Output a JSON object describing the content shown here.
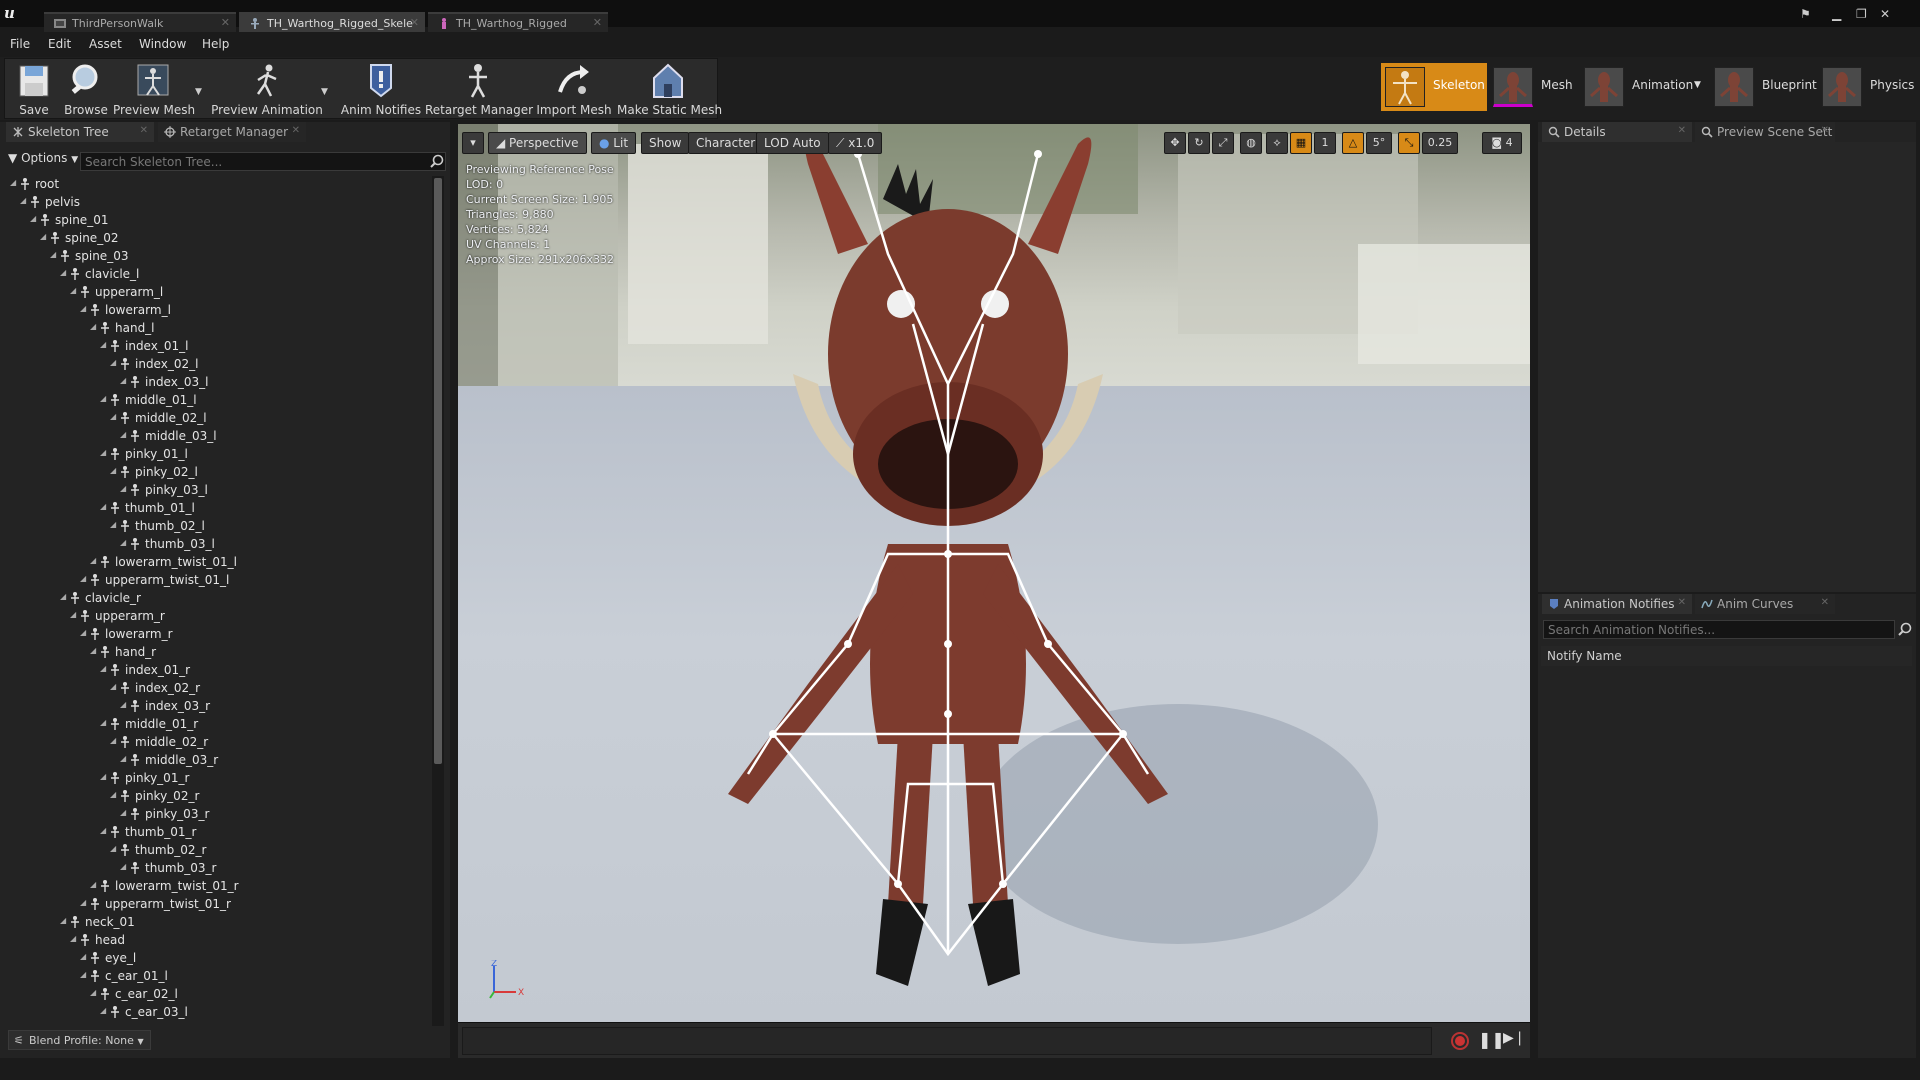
{
  "document_tabs": [
    {
      "label": "ThirdPersonWalk",
      "active": false
    },
    {
      "label": "TH_Warthog_Rigged_Skele",
      "active": true
    },
    {
      "label": "TH_Warthog_Rigged",
      "active": false
    }
  ],
  "menu": [
    "File",
    "Edit",
    "Asset",
    "Window",
    "Help"
  ],
  "toolbar": {
    "save": "Save",
    "browse": "Browse",
    "preview_mesh": "Preview Mesh",
    "preview_animation": "Preview Animation",
    "anim_notifies": "Anim Notifies",
    "retarget_manager": "Retarget Manager",
    "import_mesh": "Import Mesh",
    "make_static_mesh": "Make Static Mesh"
  },
  "modes": {
    "skeleton": "Skeleton",
    "mesh": "Mesh",
    "animation": "Animation",
    "blueprint": "Blueprint",
    "physics": "Physics",
    "active": "Skeleton",
    "accent_color": "#d88a17"
  },
  "left_panel": {
    "tabs": [
      "Skeleton Tree",
      "Retarget Manager"
    ],
    "options": "Options",
    "search_placeholder": "Search Skeleton Tree...",
    "bones": [
      {
        "name": "root",
        "depth": 0
      },
      {
        "name": "pelvis",
        "depth": 1
      },
      {
        "name": "spine_01",
        "depth": 2
      },
      {
        "name": "spine_02",
        "depth": 3
      },
      {
        "name": "spine_03",
        "depth": 4
      },
      {
        "name": "clavicle_l",
        "depth": 5
      },
      {
        "name": "upperarm_l",
        "depth": 6
      },
      {
        "name": "lowerarm_l",
        "depth": 7
      },
      {
        "name": "hand_l",
        "depth": 8
      },
      {
        "name": "index_01_l",
        "depth": 9
      },
      {
        "name": "index_02_l",
        "depth": 10
      },
      {
        "name": "index_03_l",
        "depth": 11
      },
      {
        "name": "middle_01_l",
        "depth": 9
      },
      {
        "name": "middle_02_l",
        "depth": 10
      },
      {
        "name": "middle_03_l",
        "depth": 11
      },
      {
        "name": "pinky_01_l",
        "depth": 9
      },
      {
        "name": "pinky_02_l",
        "depth": 10
      },
      {
        "name": "pinky_03_l",
        "depth": 11
      },
      {
        "name": "thumb_01_l",
        "depth": 9
      },
      {
        "name": "thumb_02_l",
        "depth": 10
      },
      {
        "name": "thumb_03_l",
        "depth": 11
      },
      {
        "name": "lowerarm_twist_01_l",
        "depth": 8
      },
      {
        "name": "upperarm_twist_01_l",
        "depth": 7
      },
      {
        "name": "clavicle_r",
        "depth": 5
      },
      {
        "name": "upperarm_r",
        "depth": 6
      },
      {
        "name": "lowerarm_r",
        "depth": 7
      },
      {
        "name": "hand_r",
        "depth": 8
      },
      {
        "name": "index_01_r",
        "depth": 9
      },
      {
        "name": "index_02_r",
        "depth": 10
      },
      {
        "name": "index_03_r",
        "depth": 11
      },
      {
        "name": "middle_01_r",
        "depth": 9
      },
      {
        "name": "middle_02_r",
        "depth": 10
      },
      {
        "name": "middle_03_r",
        "depth": 11
      },
      {
        "name": "pinky_01_r",
        "depth": 9
      },
      {
        "name": "pinky_02_r",
        "depth": 10
      },
      {
        "name": "pinky_03_r",
        "depth": 11
      },
      {
        "name": "thumb_01_r",
        "depth": 9
      },
      {
        "name": "thumb_02_r",
        "depth": 10
      },
      {
        "name": "thumb_03_r",
        "depth": 11
      },
      {
        "name": "lowerarm_twist_01_r",
        "depth": 8
      },
      {
        "name": "upperarm_twist_01_r",
        "depth": 7
      },
      {
        "name": "neck_01",
        "depth": 5
      },
      {
        "name": "head",
        "depth": 6
      },
      {
        "name": "eye_l",
        "depth": 7
      },
      {
        "name": "c_ear_01_l",
        "depth": 7
      },
      {
        "name": "c_ear_02_l",
        "depth": 8
      },
      {
        "name": "c_ear_03_l",
        "depth": 9
      }
    ],
    "blend_profile": "Blend Profile: None"
  },
  "viewport": {
    "buttons": {
      "perspective": "Perspective",
      "lit": "Lit",
      "show": "Show",
      "character": "Character",
      "lod": "LOD Auto",
      "speed": "x1.0"
    },
    "grid_snap": "1",
    "rotation_snap": "5°",
    "scale_snap": "0.25",
    "camera_speed": "4",
    "info": [
      "Previewing Reference Pose",
      "LOD: 0",
      "Current Screen Size: 1.905",
      "Triangles: 9,880",
      "Vertices: 5,824",
      "UV Channels: 1",
      "Approx Size: 291x206x332"
    ],
    "axis": {
      "z": "Z",
      "x": "X"
    }
  },
  "right_panel": {
    "top_tabs": [
      "Details",
      "Preview Scene Sett"
    ],
    "bottom_tabs": [
      "Animation Notifies",
      "Anim Curves"
    ],
    "notify_search_placeholder": "Search Animation Notifies...",
    "notify_header": "Notify Name"
  }
}
